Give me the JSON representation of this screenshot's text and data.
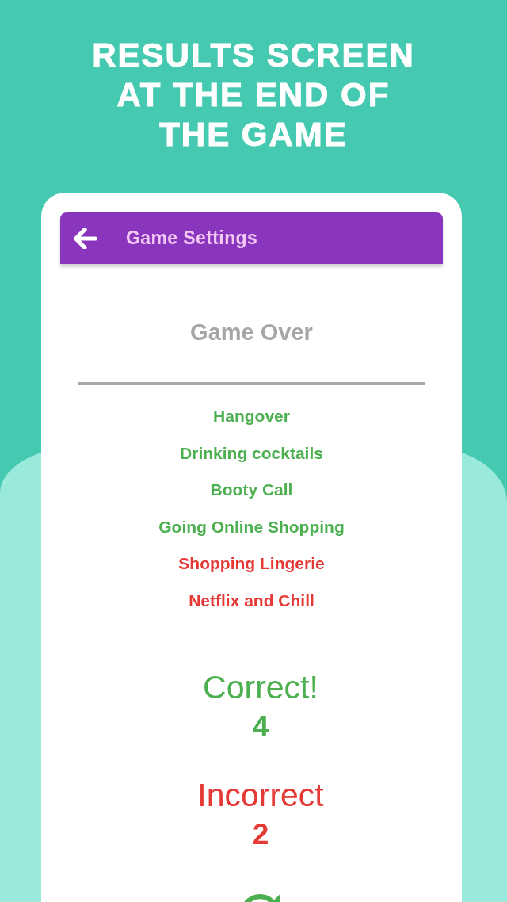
{
  "header": {
    "title": "RESULTS SCREEN AT THE END OF THE GAME"
  },
  "app_bar": {
    "title": "Game Settings"
  },
  "results": {
    "heading": "Game Over",
    "items": [
      {
        "label": "Hangover",
        "correct": true
      },
      {
        "label": "Drinking cocktails",
        "correct": true
      },
      {
        "label": "Booty Call",
        "correct": true
      },
      {
        "label": "Going Online Shopping",
        "correct": true
      },
      {
        "label": "Shopping Lingerie",
        "correct": false
      },
      {
        "label": "Netflix and Chill",
        "correct": false
      }
    ]
  },
  "score": [
    {
      "kind": "correct",
      "label": "Correct!",
      "count": "4"
    },
    {
      "kind": "incorrect",
      "label": "Incorrect",
      "count": "2"
    }
  ]
}
